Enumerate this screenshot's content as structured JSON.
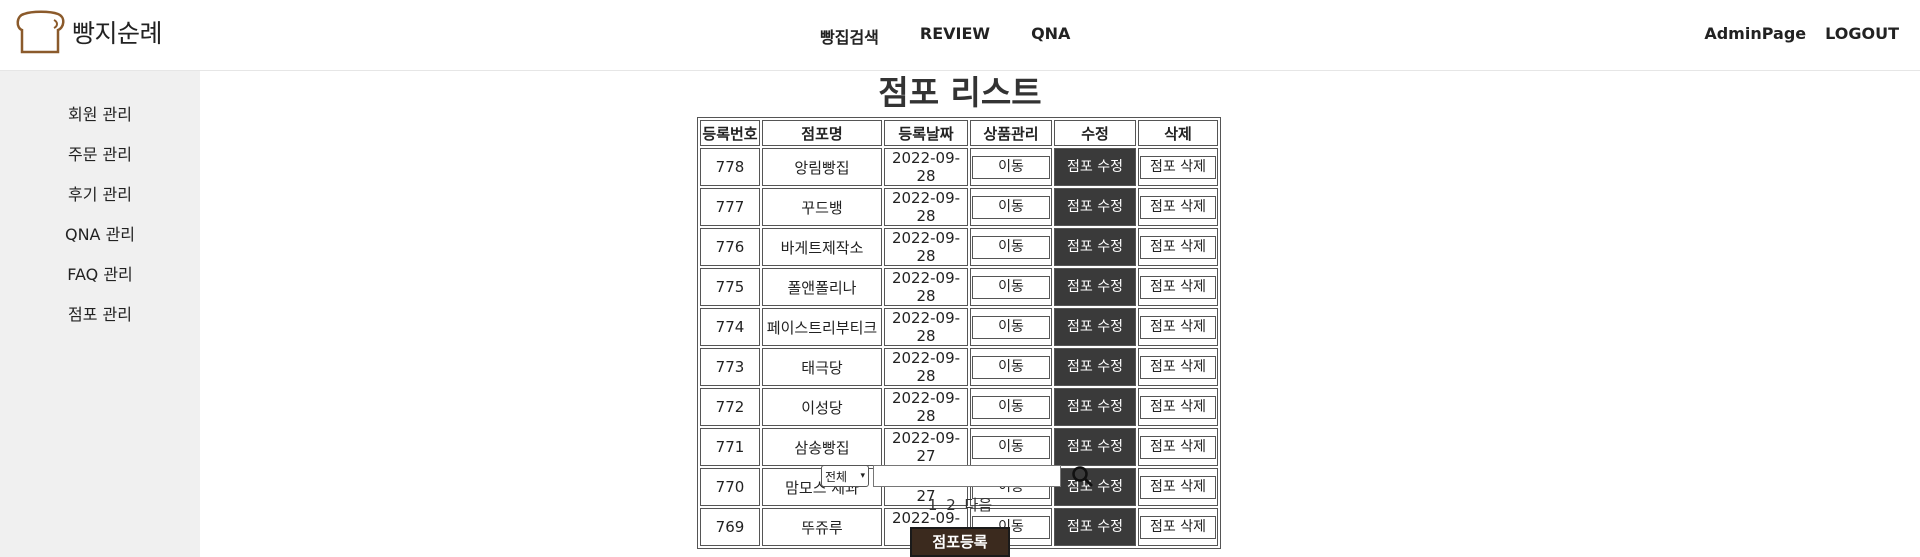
{
  "header": {
    "logo_text": "빵지순례",
    "nav": [
      "빵집검색",
      "REVIEW",
      "QNA"
    ],
    "admin_link": "AdminPage",
    "logout_link": "LOGOUT"
  },
  "sidebar": {
    "items": [
      "회원 관리",
      "주문 관리",
      "후기 관리",
      "QNA 관리",
      "FAQ 관리",
      "점포 관리"
    ]
  },
  "main": {
    "title": "점포 리스트",
    "columns": [
      "등록번호",
      "점포명",
      "등록날짜",
      "상품관리",
      "수정",
      "삭제"
    ],
    "rows": [
      {
        "id": "778",
        "name": "앙림빵집",
        "date": "2022-09-28",
        "move": "이동",
        "edit": "점포 수정",
        "delete": "점포 삭제"
      },
      {
        "id": "777",
        "name": "꾸드뱅",
        "date": "2022-09-28",
        "move": "이동",
        "edit": "점포 수정",
        "delete": "점포 삭제"
      },
      {
        "id": "776",
        "name": "바게트제작소",
        "date": "2022-09-28",
        "move": "이동",
        "edit": "점포 수정",
        "delete": "점포 삭제"
      },
      {
        "id": "775",
        "name": "폴앤폴리나",
        "date": "2022-09-28",
        "move": "이동",
        "edit": "점포 수정",
        "delete": "점포 삭제"
      },
      {
        "id": "774",
        "name": "페이스트리부티크",
        "date": "2022-09-28",
        "move": "이동",
        "edit": "점포 수정",
        "delete": "점포 삭제"
      },
      {
        "id": "773",
        "name": "태극당",
        "date": "2022-09-28",
        "move": "이동",
        "edit": "점포 수정",
        "delete": "점포 삭제"
      },
      {
        "id": "772",
        "name": "이성당",
        "date": "2022-09-28",
        "move": "이동",
        "edit": "점포 수정",
        "delete": "점포 삭제"
      },
      {
        "id": "771",
        "name": "삼송빵집",
        "date": "2022-09-27",
        "move": "이동",
        "edit": "점포 수정",
        "delete": "점포 삭제"
      },
      {
        "id": "770",
        "name": "맘모스 제과",
        "date": "2022-09-27",
        "move": "이동",
        "edit": "점포 수정",
        "delete": "점포 삭제"
      },
      {
        "id": "769",
        "name": "뚜쥬루",
        "date": "2022-09-27",
        "move": "이동",
        "edit": "점포 수정",
        "delete": "점포 삭제"
      }
    ]
  },
  "search": {
    "select_value": "전체",
    "input_value": "",
    "icon": "search-icon"
  },
  "pagination": {
    "pages": [
      "1",
      "2"
    ],
    "next": "다음"
  },
  "register_button": "점포등록",
  "colors": {
    "sidebar_bg": "#f0f0f0",
    "edit_button_bg": "#3a3a3a",
    "register_button_bg": "#3b2a1e",
    "logo_brown": "#8b5a2b"
  }
}
